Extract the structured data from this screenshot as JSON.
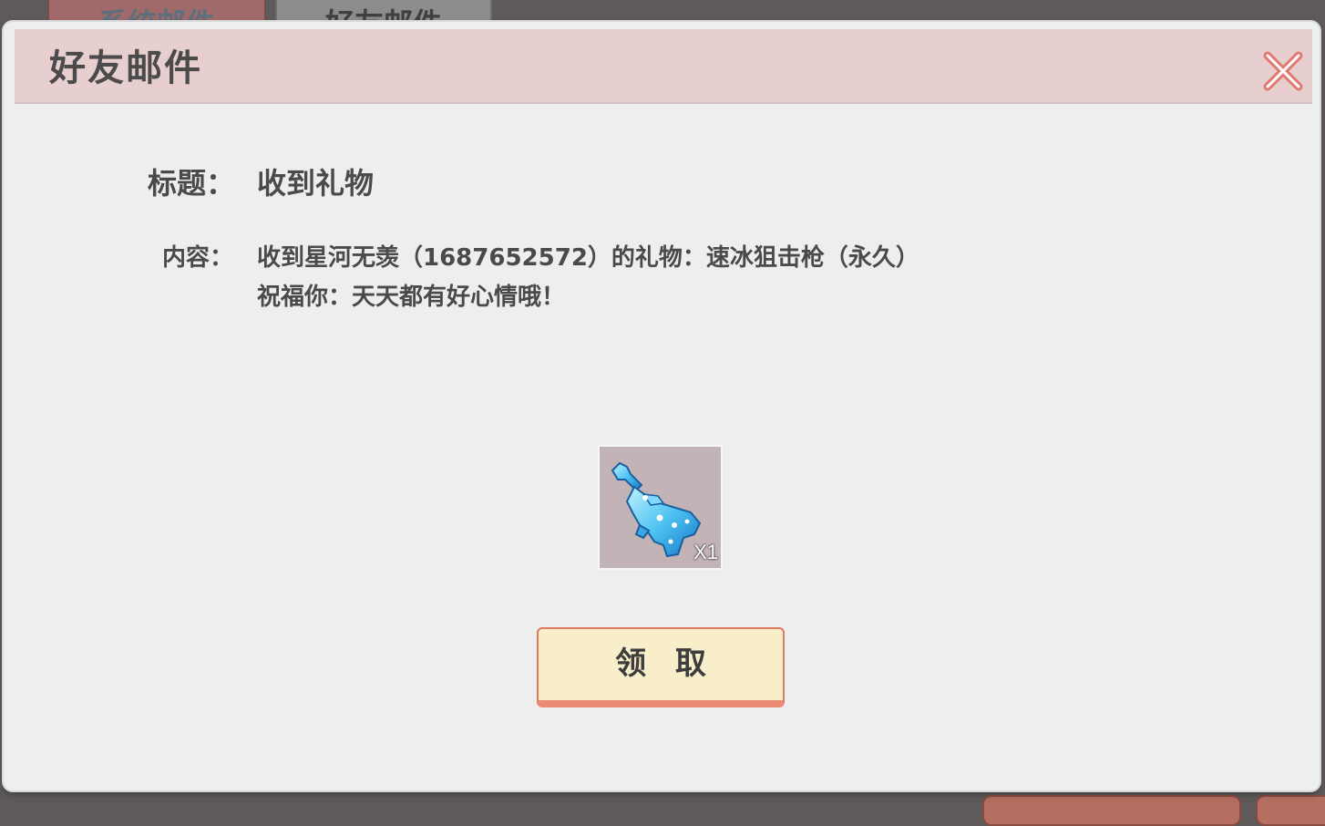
{
  "background": {
    "tabs": [
      "系统邮件",
      "好友邮件"
    ]
  },
  "dialog": {
    "title": "好友邮件",
    "close_icon": "close-icon"
  },
  "mail": {
    "title_label": "标题：",
    "title_value": "收到礼物",
    "content_label": "内容：",
    "content_line1": "收到星河无羡（1687652572）的礼物：速冰狙击枪（永久）",
    "content_line2": "祝福你：天天都有好心情哦！"
  },
  "attachment": {
    "icon": "ice-sniper-rifle-icon",
    "quantity": "X1"
  },
  "actions": {
    "claim_label": "领 取"
  },
  "colors": {
    "header_bg": "#e8cfcf",
    "dialog_bg": "#edefee",
    "button_bg": "#f8eeca",
    "button_border": "#eb8b74",
    "close_icon": "#e07a70"
  }
}
